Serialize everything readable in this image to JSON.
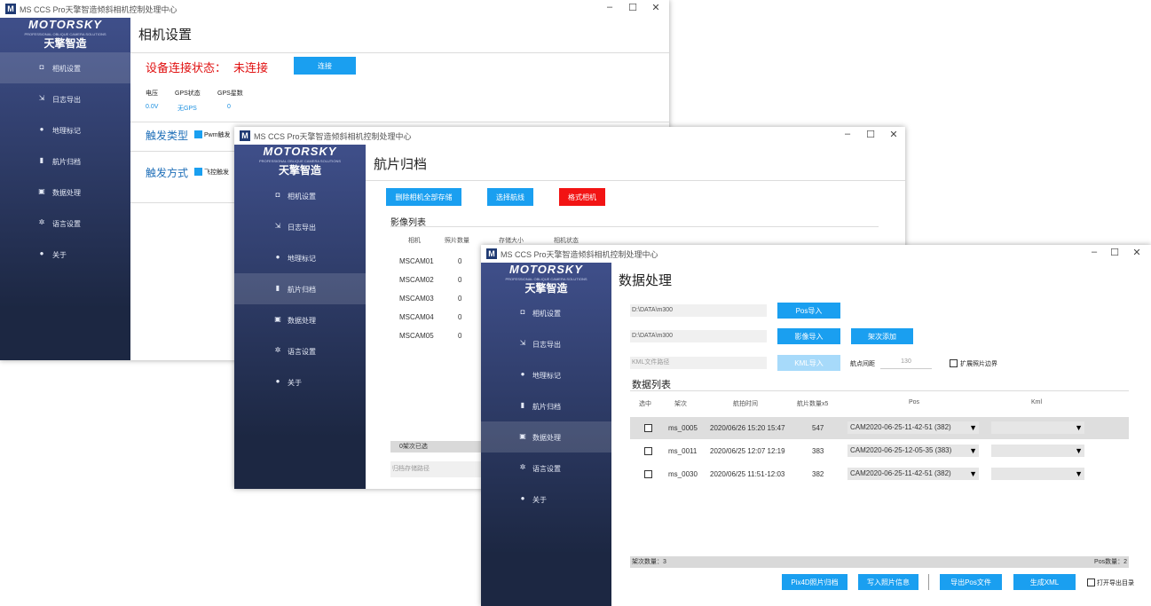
{
  "app_title": "MS CCS Pro天擎智造倾斜相机控制处理中心",
  "logo": {
    "brand": "MOTORSKY",
    "tagline": "PROFESSIONAL OBLIQUE CAMERA SOLUTIONS",
    "cn_name": "天擎智造"
  },
  "nav": [
    {
      "icon": "camera-icon",
      "label": "相机设置"
    },
    {
      "icon": "export-icon",
      "label": "日志导出"
    },
    {
      "icon": "map-pin-icon",
      "label": "地理标记"
    },
    {
      "icon": "archive-icon",
      "label": "航片归档"
    },
    {
      "icon": "data-process-icon",
      "label": "数据处理"
    },
    {
      "icon": "language-icon",
      "label": "语言设置"
    },
    {
      "icon": "info-icon",
      "label": "关于"
    }
  ],
  "window_controls": {
    "minimize": "–",
    "maximize": "☐",
    "close": "✕"
  },
  "win1": {
    "page_title": "相机设置",
    "status_label": "设备连接状态：",
    "status_value": "未连接",
    "connect_button": "连接",
    "info_headers": [
      "电压",
      "GPS状态",
      "GPS星数"
    ],
    "info_values": [
      "0.0V",
      "无GPS",
      "0"
    ],
    "trigger_type_label": "触发类型",
    "trigger_type_option": "Pwm触发",
    "trigger_mode_label": "触发方式",
    "trigger_mode_option": "飞控触发"
  },
  "win2": {
    "page_title": "航片归档",
    "buttons": {
      "read_camera": "删除相机全部存储",
      "select_folder": "选择航线",
      "format": "格式相机"
    },
    "section_title": "影像列表",
    "columns": [
      "相机",
      "照片数量",
      "存储大小",
      "相机状态"
    ],
    "rows": [
      {
        "camera": "MSCAM01",
        "count": "0"
      },
      {
        "camera": "MSCAM02",
        "count": "0"
      },
      {
        "camera": "MSCAM03",
        "count": "0"
      },
      {
        "camera": "MSCAM04",
        "count": "0"
      },
      {
        "camera": "MSCAM05",
        "count": "0"
      }
    ],
    "status_bar": "0架次已选",
    "path_placeholder": "归档存储路径"
  },
  "win3": {
    "page_title": "数据处理",
    "pos_path": "D:\\DATA\\m300",
    "pos_button": "Pos导入",
    "image_path": "D:\\DATA\\m300",
    "image_button": "影像导入",
    "folder_button": "架次添加",
    "kml_placeholder": "KML文件路径",
    "kml_button": "KML导入",
    "ratio_label": "航点间距",
    "ratio_value": "130",
    "extend_checkbox": "扩展照片边界",
    "section_title": "数据列表",
    "columns": [
      "选中",
      "架次",
      "航拍时间",
      "航片数量x5",
      "Pos",
      "Kml"
    ],
    "rows": [
      {
        "id": "ms_0005",
        "time": "2020/06/26 15:20 15:47",
        "count": "547",
        "pos": "CAM2020-06-25-11-42-51 (382)",
        "selected": true
      },
      {
        "id": "ms_0011",
        "time": "2020/06/25 12:07 12:19",
        "count": "383",
        "pos": "CAM2020-06-25-12-05-35 (383)",
        "selected": false
      },
      {
        "id": "ms_0030",
        "time": "2020/06/25 11:51-12:03",
        "count": "382",
        "pos": "CAM2020-06-25-11-42-51 (382)",
        "selected": false
      }
    ],
    "footer_left": "架次数量：3",
    "footer_right": "Pos数量：2",
    "bottom_buttons": {
      "pix4d": "Pix4D照片归档",
      "write_exif": "写入照片信息",
      "export_pos": "导出Pos文件",
      "gen_xml": "生成XML"
    },
    "open_folder_checkbox": "打开导出目录"
  },
  "colors": {
    "accent": "#1a9ff0",
    "danger": "#f21414",
    "sidebar_top": "#3f4f8a",
    "sidebar_bottom": "#1c2742"
  }
}
